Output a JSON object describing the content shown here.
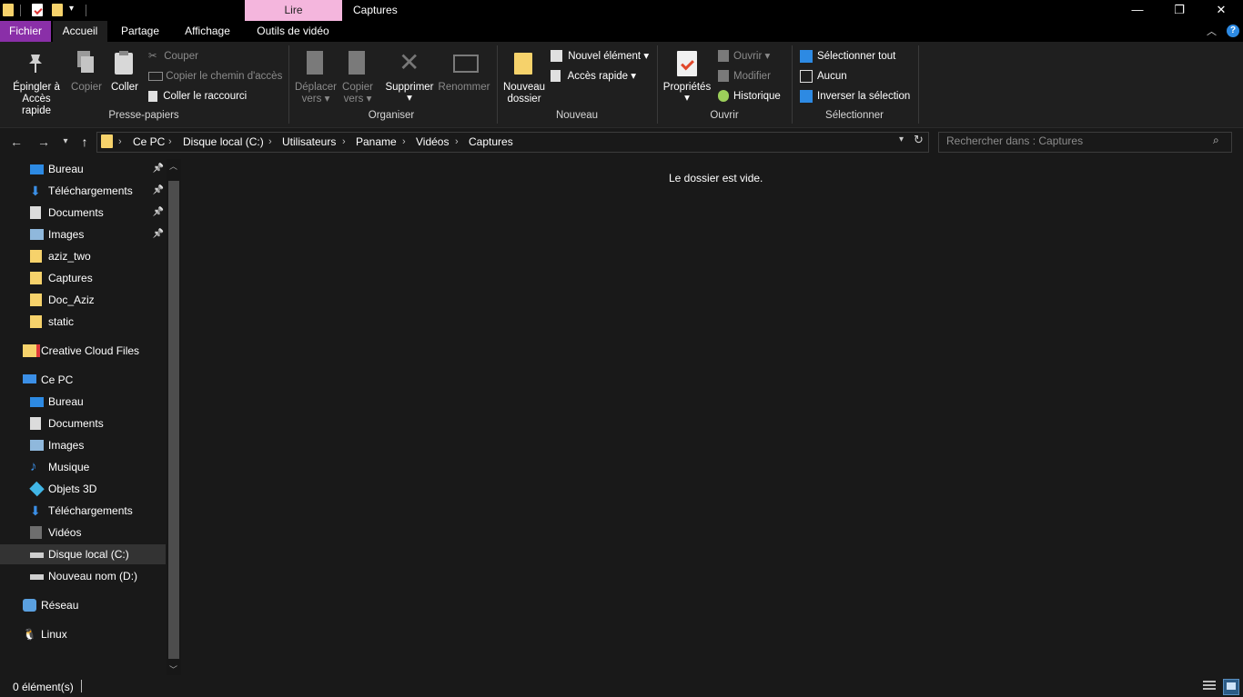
{
  "window": {
    "title": "Captures",
    "context_tab": "Lire",
    "minimize_glyph": "—",
    "restore_glyph": "❐",
    "close_glyph": "✕"
  },
  "ribbon_tabs": [
    "Fichier",
    "Accueil",
    "Partage",
    "Affichage",
    "Outils de vidéo"
  ],
  "ribbon": {
    "clipboard": {
      "pin_line1": "Épingler à",
      "pin_line2": "Accès rapide",
      "copy": "Copier",
      "paste": "Coller",
      "cut": "Couper",
      "copy_path": "Copier le chemin d'accès",
      "paste_shortcut": "Coller le raccourci",
      "group": "Presse-papiers"
    },
    "organize": {
      "move_line1": "Déplacer",
      "move_line2": "vers",
      "copyto_line1": "Copier",
      "copyto_line2": "vers",
      "delete": "Supprimer",
      "rename": "Renommer",
      "group": "Organiser"
    },
    "new": {
      "folder_line1": "Nouveau",
      "folder_line2": "dossier",
      "new_item": "Nouvel élément",
      "quick_access": "Accès rapide",
      "group": "Nouveau"
    },
    "open": {
      "properties": "Propriétés",
      "open": "Ouvrir",
      "edit": "Modifier",
      "history": "Historique",
      "group": "Ouvrir"
    },
    "select": {
      "select_all": "Sélectionner tout",
      "none": "Aucun",
      "invert": "Inverser la sélection",
      "group": "Sélectionner"
    }
  },
  "address": {
    "crumbs": [
      "Ce PC",
      "Disque local (C:)",
      "Utilisateurs",
      "Paname",
      "Vidéos",
      "Captures"
    ],
    "search_placeholder": "Rechercher dans : Captures"
  },
  "sidebar": {
    "quick_access": [
      {
        "label": "Bureau",
        "icon": "desktop-icon",
        "pinned": true
      },
      {
        "label": "Téléchargements",
        "icon": "download-icon",
        "pinned": true
      },
      {
        "label": "Documents",
        "icon": "documents-icon",
        "pinned": true
      },
      {
        "label": "Images",
        "icon": "images-icon",
        "pinned": true
      },
      {
        "label": "aziz_two",
        "icon": "folder-icon",
        "pinned": false
      },
      {
        "label": "Captures",
        "icon": "folder-icon",
        "pinned": false
      },
      {
        "label": "Doc_Aziz",
        "icon": "folder-icon",
        "pinned": false
      },
      {
        "label": "static",
        "icon": "folder-icon",
        "pinned": false
      }
    ],
    "creative_cloud": "Creative Cloud Files",
    "this_pc": "Ce PC",
    "pc_items": [
      {
        "label": "Bureau",
        "icon": "desktop-icon"
      },
      {
        "label": "Documents",
        "icon": "documents-icon"
      },
      {
        "label": "Images",
        "icon": "images-icon"
      },
      {
        "label": "Musique",
        "icon": "music-icon"
      },
      {
        "label": "Objets 3D",
        "icon": "3d-objects-icon"
      },
      {
        "label": "Téléchargements",
        "icon": "download-icon"
      },
      {
        "label": "Vidéos",
        "icon": "videos-icon"
      },
      {
        "label": "Disque local (C:)",
        "icon": "drive-icon",
        "selected": true
      },
      {
        "label": "Nouveau nom (D:)",
        "icon": "drive-icon"
      }
    ],
    "network": "Réseau",
    "linux": "Linux"
  },
  "content": {
    "empty_message": "Le dossier est vide."
  },
  "status": {
    "item_count": "0 élément(s)"
  },
  "colors": {
    "file_tab": "#8a2fa8",
    "context_tab": "#f4b6dd",
    "folder": "#f6d26b",
    "accent_blue": "#2d8ae3"
  }
}
